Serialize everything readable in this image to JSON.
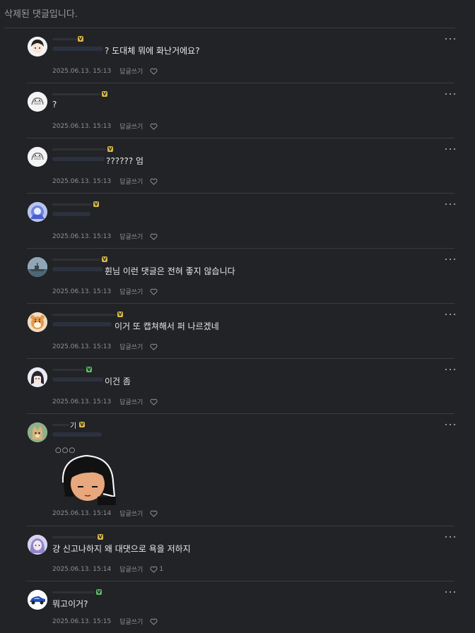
{
  "header": {
    "deleted_notice": "삭제된 댓글입니다."
  },
  "colors": {
    "background": "#222326",
    "divider": "#3b3c40",
    "meta": "#8e8f94",
    "text": "#e9e9ea"
  },
  "comments": [
    {
      "avatar": "anime-avatar",
      "badge": "gold",
      "text": "? 도대체 뭐에 화난거에요?",
      "date": "2025.06.13. 15:13",
      "reply": "답글쓰기"
    },
    {
      "avatar": "sketch-avatar",
      "badge": "gold",
      "text": "?",
      "date": "2025.06.13. 15:13",
      "reply": "답글쓰기"
    },
    {
      "avatar": "sketch-avatar",
      "badge": "gold",
      "text": "?????? 엄",
      "date": "2025.06.13. 15:13",
      "reply": "답글쓰기"
    },
    {
      "avatar": "blue-character-avatar",
      "badge": "gold",
      "text": "",
      "date": "2025.06.13. 15:13",
      "reply": "답글쓰기"
    },
    {
      "avatar": "warship-avatar",
      "badge": "gold",
      "text": "휜님 이런 댓글은 전혀 좋지 않습니다",
      "date": "2025.06.13. 15:13",
      "reply": "답글쓰기"
    },
    {
      "avatar": "tiger-avatar",
      "badge": "gold",
      "text": "이거 또 캡쳐해서 퍼 나르겠네",
      "date": "2025.06.13. 15:13",
      "reply": "답글쓰기"
    },
    {
      "avatar": "dark-hair-avatar",
      "badge": "green",
      "text": "이건 좀",
      "date": "2025.06.13. 15:13",
      "reply": "답글쓰기"
    },
    {
      "avatar": "cat-avatar",
      "badge": "gold",
      "nick_visible": "기",
      "dots": "○○○",
      "sticker": "girl-sticker",
      "date": "2025.06.13. 15:14",
      "reply": "답글쓰기"
    },
    {
      "avatar": "purple-anime-avatar",
      "badge": "gold",
      "text": "걍 신고나하지 왜 대댓으로 욕을 저하지",
      "date": "2025.06.13. 15:14",
      "reply": "답글쓰기",
      "likes": "1"
    },
    {
      "avatar": "blue-car-avatar",
      "badge": "green",
      "text": "뭐고이거?",
      "date": "2025.06.13. 15:15",
      "reply": "답글쓰기"
    }
  ]
}
